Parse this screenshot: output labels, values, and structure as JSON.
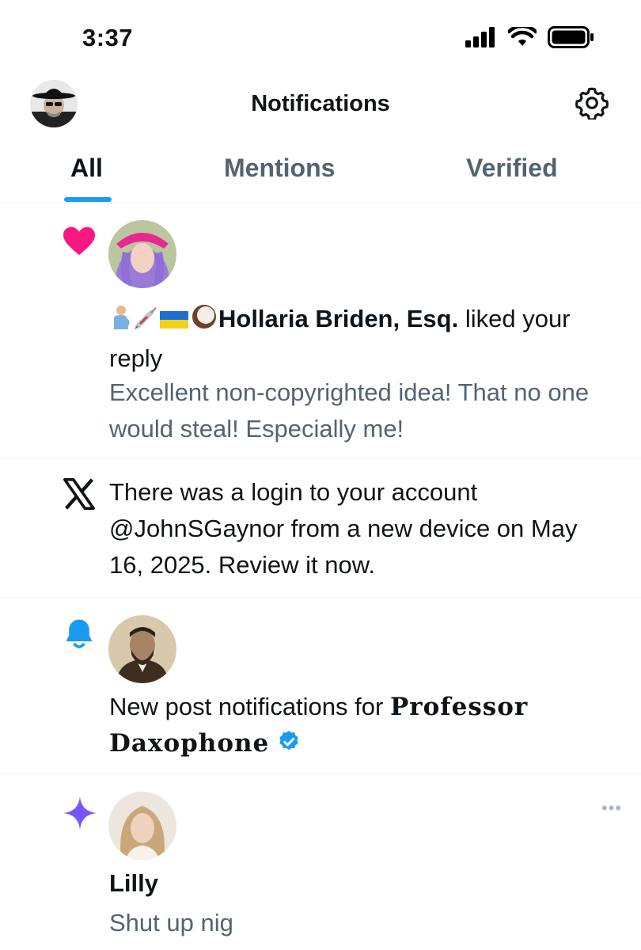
{
  "status_bar": {
    "time": "3:37",
    "icons": [
      "signal-icon",
      "wifi-icon",
      "battery-icon"
    ]
  },
  "header": {
    "title": "Notifications",
    "avatar": "user-avatar",
    "settings_icon": "gear-icon"
  },
  "tabs": [
    {
      "label": "All",
      "active": true
    },
    {
      "label": "Mentions",
      "active": false
    },
    {
      "label": "Verified",
      "active": false
    }
  ],
  "notifications": [
    {
      "type": "like",
      "icon": "heart-icon",
      "emoji_prefix": [
        "pregnant-man-emoji",
        "syringe-emoji",
        "ukraine-flag-emoji",
        "coconut-emoji"
      ],
      "name": "Hollaria Briden, Esq.",
      "action": "liked your reply",
      "preview": "Excellent non-copyrighted idea! That no one would steal! Especially me!"
    },
    {
      "type": "system",
      "icon": "x-logo-icon",
      "text": "There was a login to your account @JohnSGaynor from a new device on May 16, 2025. Review it now."
    },
    {
      "type": "post-notification",
      "icon": "bell-icon",
      "text": "New post notifications for",
      "name": "Professor Daxophone",
      "badge": "verified-badge-icon"
    },
    {
      "type": "recommended",
      "icon": "sparkle-icon",
      "name": "Lilly",
      "preview": "Shut up nig",
      "more": "•••"
    }
  ],
  "colors": {
    "accent": "#1d9bf0",
    "like": "#f91880",
    "sparkle": "#7856ff",
    "muted": "#536471"
  }
}
